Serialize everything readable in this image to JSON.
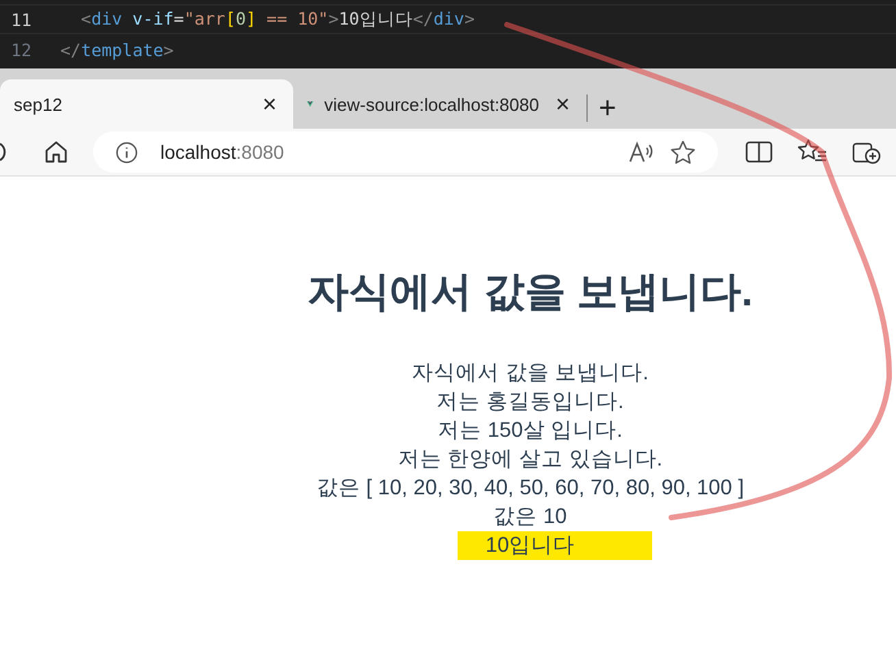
{
  "editor": {
    "lines": [
      {
        "number": "11",
        "current": true,
        "tokens": [
          {
            "text": "  <",
            "kind": "punct"
          },
          {
            "text": "div",
            "kind": "tag"
          },
          {
            "text": " v-if",
            "kind": "attr"
          },
          {
            "text": "=",
            "kind": "plain"
          },
          {
            "text": "\"arr",
            "kind": "string"
          },
          {
            "text": "[",
            "kind": "bracket"
          },
          {
            "text": "0",
            "kind": "number"
          },
          {
            "text": "]",
            "kind": "bracket"
          },
          {
            "text": " == 10\"",
            "kind": "string"
          },
          {
            "text": ">",
            "kind": "punct"
          },
          {
            "text": "10입니다",
            "kind": "plain"
          },
          {
            "text": "</",
            "kind": "punct"
          },
          {
            "text": "div",
            "kind": "tag"
          },
          {
            "text": ">",
            "kind": "punct"
          }
        ]
      },
      {
        "number": "12",
        "current": false,
        "tokens": [
          {
            "text": "</",
            "kind": "punct"
          },
          {
            "text": "template",
            "kind": "tag"
          },
          {
            "text": ">",
            "kind": "punct"
          }
        ]
      }
    ]
  },
  "tabs": [
    {
      "label": "sep12",
      "selected": true,
      "close": "×"
    },
    {
      "label": "view-source:localhost:8080",
      "selected": false,
      "close": "×"
    }
  ],
  "new_tab": "+",
  "address": {
    "host": "localhost",
    "port": ":8080"
  },
  "page": {
    "heading": "자식에서 값을 보냅니다.",
    "lines": [
      {
        "text": "자식에서 값을 보냅니다.",
        "highlighted": false
      },
      {
        "text": "저는 홍길동입니다.",
        "highlighted": false
      },
      {
        "text": "저는 150살 입니다.",
        "highlighted": false
      },
      {
        "text": "저는 한양에 살고 있습니다.",
        "highlighted": false
      },
      {
        "text": "값은 [ 10, 20, 30, 40, 50, 60, 70, 80, 90, 100 ]",
        "highlighted": false
      },
      {
        "text": "값은 10",
        "highlighted": false
      },
      {
        "text": "10입니다",
        "highlighted": true
      }
    ]
  }
}
